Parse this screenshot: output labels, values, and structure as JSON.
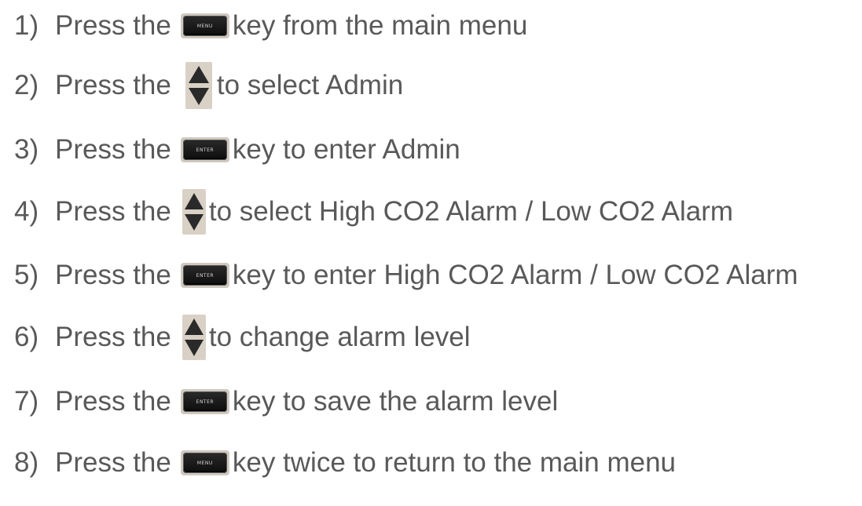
{
  "steps": [
    {
      "number": "1)",
      "lead": "Press the",
      "key": "menu",
      "rest": "key from the main menu"
    },
    {
      "number": "2)",
      "lead": "Press the",
      "key": "arrows",
      "rest": "to select Admin"
    },
    {
      "number": "3)",
      "lead": "Press the",
      "key": "enter",
      "rest": "key to enter Admin"
    },
    {
      "number": "4)",
      "lead": "Press the",
      "key": "arrows",
      "rest": "to select High CO2 Alarm / Low CO2 Alarm"
    },
    {
      "number": "5)",
      "lead": "Press the",
      "key": "enter",
      "rest": "key to enter High CO2 Alarm / Low CO2 Alarm"
    },
    {
      "number": "6)",
      "lead": "Press the",
      "key": "arrows",
      "rest": "to change alarm level"
    },
    {
      "number": "7)",
      "lead": "Press the",
      "key": "enter",
      "rest": "key to save the alarm level"
    },
    {
      "number": "8)",
      "lead": "Press the",
      "key": "menu",
      "rest": "key twice to return to the main menu"
    }
  ],
  "keys": {
    "menu_label": "MENU",
    "enter_label": "ENTER"
  },
  "colors": {
    "text": "#595959",
    "key_face": "#111111",
    "key_surround": "#cfc8c0",
    "arrow_fill": "#2a2a2a"
  }
}
